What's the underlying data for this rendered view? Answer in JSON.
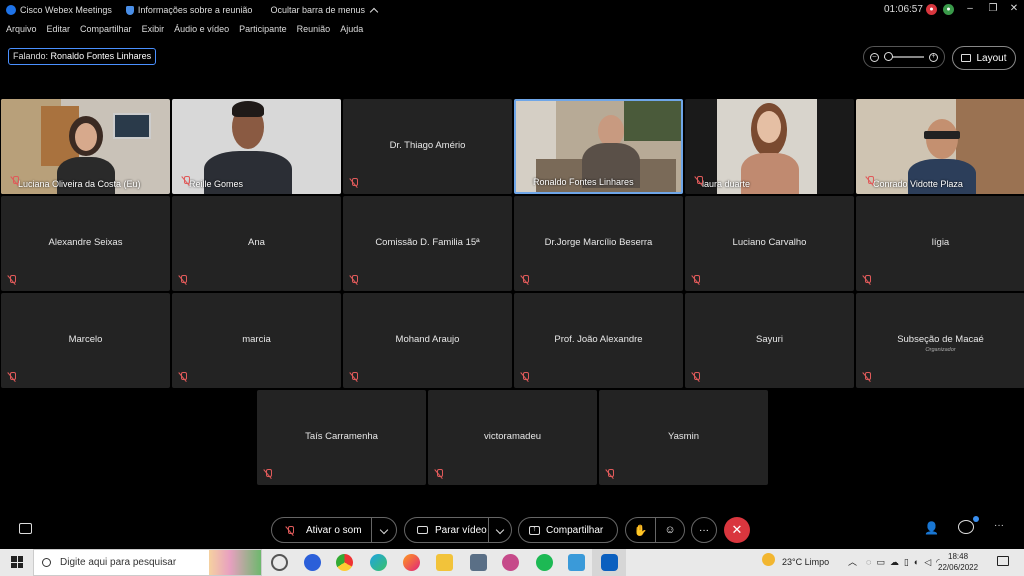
{
  "titlebar": {
    "app_title": "Cisco Webex Meetings",
    "info_label": "Informações sobre a reunião",
    "hide_menu_label": "Ocultar barra de menus",
    "timer": "01:06:57"
  },
  "menu": [
    "Arquivo",
    "Editar",
    "Compartilhar",
    "Exibir",
    "Áudio e vídeo",
    "Participante",
    "Reunião",
    "Ajuda"
  ],
  "speaking": {
    "prefix": "Falando:",
    "name": "Ronaldo Fontes Linhares"
  },
  "layout_button": "Layout",
  "video_participants": [
    {
      "name": "Luciana Oliveira da Costa (Eu)"
    },
    {
      "name": "Reille Gomes"
    },
    {
      "name": "Dr. Thiago Amério"
    },
    {
      "name": "Ronaldo Fontes Linhares"
    },
    {
      "name": "laura duarte"
    },
    {
      "name": "Conrado Vidotte Plaza"
    }
  ],
  "participants": [
    {
      "name": "Alexandre Seixas"
    },
    {
      "name": "Ana"
    },
    {
      "name": "Comissão D. Familia 15ª"
    },
    {
      "name": "Dr.Jorge Marcílio Beserra"
    },
    {
      "name": "Luciano Carvalho"
    },
    {
      "name": "lígia"
    },
    {
      "name": "Marcelo"
    },
    {
      "name": "marcia"
    },
    {
      "name": "Mohand Araujo"
    },
    {
      "name": "Prof. João Alexandre"
    },
    {
      "name": "Sayuri"
    },
    {
      "name": "Subseção de Macaé",
      "role": "Organizador"
    },
    {
      "name": "Taís Carramenha"
    },
    {
      "name": "victoramadeu"
    },
    {
      "name": "Yasmin"
    }
  ],
  "controls": {
    "mute": "Ativar o som",
    "video": "Parar vídeo",
    "share": "Compartilhar",
    "more": "···",
    "end": "✕"
  },
  "taskbar": {
    "search_placeholder": "Digite aqui para pesquisar",
    "weather": "23°C  Limpo",
    "time": "18:48",
    "date": "22/06/2022"
  },
  "colors": {
    "accent": "#4a90ff",
    "end_call": "#d9363e",
    "tile_bg": "#232323"
  }
}
